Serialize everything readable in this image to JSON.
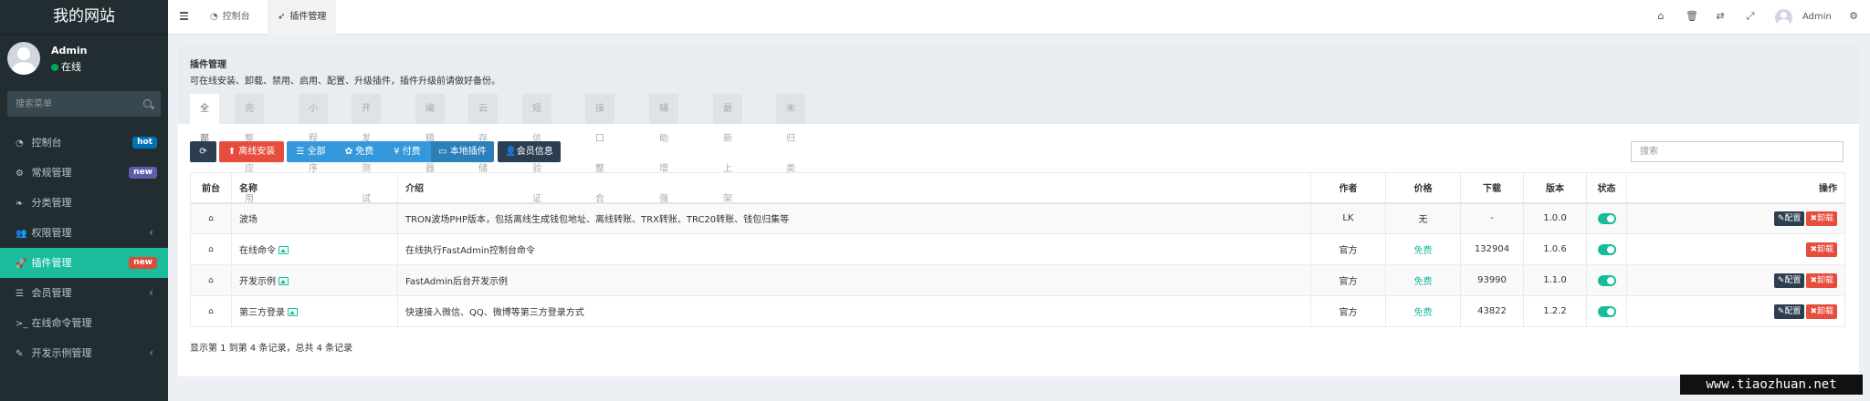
{
  "sidebar": {
    "brand": "我的网站",
    "user": {
      "name": "Admin",
      "status": "在线"
    },
    "search_placeholder": "搜索菜单",
    "items": [
      {
        "icon": "dashboard-icon",
        "label": "控制台",
        "badge": "hot"
      },
      {
        "icon": "cogs-icon",
        "label": "常规管理",
        "badge": "new"
      },
      {
        "icon": "leaf-icon",
        "label": "分类管理"
      },
      {
        "icon": "users-icon",
        "label": "权限管理"
      },
      {
        "icon": "rocket-icon",
        "label": "插件管理",
        "badge": "new",
        "active": true
      },
      {
        "icon": "list-icon",
        "label": "会员管理"
      },
      {
        "icon": "terminal-icon",
        "label": "在线命令管理"
      },
      {
        "icon": "magic-icon",
        "label": "开发示例管理"
      }
    ]
  },
  "topnav": {
    "tabs": [
      {
        "icon": "dashboard-icon",
        "label": "控制台"
      },
      {
        "icon": "rocket-icon",
        "label": "插件管理",
        "active": true
      }
    ],
    "right_icons": [
      "home-icon",
      "trash-icon",
      "translate-icon",
      "fullscreen-icon"
    ],
    "admin": "Admin"
  },
  "page": {
    "title": "插件管理",
    "description": "可在线安装、卸载、禁用、启用、配置、升级插件，插件升级前请做好备份。",
    "categories": [
      "全部",
      "完整应用",
      "小程序",
      "开发测试",
      "编辑器",
      "云存储",
      "短信验证",
      "接口整合",
      "辅助增强",
      "最新上架",
      "未归类"
    ],
    "toolbar": {
      "offline_install": "离线安装",
      "filter_all": "全部",
      "filter_free": "免费",
      "filter_paid": "付费",
      "local_plugins": "本地插件",
      "member_info": "会员信息",
      "search_placeholder": "搜索"
    },
    "table": {
      "headers": [
        "前台",
        "名称",
        "介绍",
        "作者",
        "价格",
        "下载",
        "版本",
        "状态",
        "操作"
      ],
      "rows": [
        {
          "name": "波场",
          "intro": "TRON波场PHP版本，包括离线生成钱包地址、离线转账、TRX转账、TRC20转账、钱包归集等",
          "author": "LK",
          "price": "无",
          "downloads": "-",
          "version": "1.0.0",
          "configurable": true
        },
        {
          "name": "在线命令",
          "intro": "在线执行FastAdmin控制台命令",
          "author": "官方",
          "price": "免费",
          "downloads": "132904",
          "version": "1.0.6",
          "configurable": false
        },
        {
          "name": "开发示例",
          "intro": "FastAdmin后台开发示例",
          "author": "官方",
          "price": "免费",
          "downloads": "93990",
          "version": "1.1.0",
          "configurable": true
        },
        {
          "name": "第三方登录",
          "intro": "快速接入微信、QQ、微博等第三方登录方式",
          "author": "官方",
          "price": "免费",
          "downloads": "43822",
          "version": "1.2.2",
          "configurable": true
        }
      ],
      "config_label": "配置",
      "uninstall_label": "卸载"
    },
    "footer": "显示第 1 到第 4 条记录，总共 4 条记录"
  },
  "watermark": "www.tiaozhuan.net"
}
